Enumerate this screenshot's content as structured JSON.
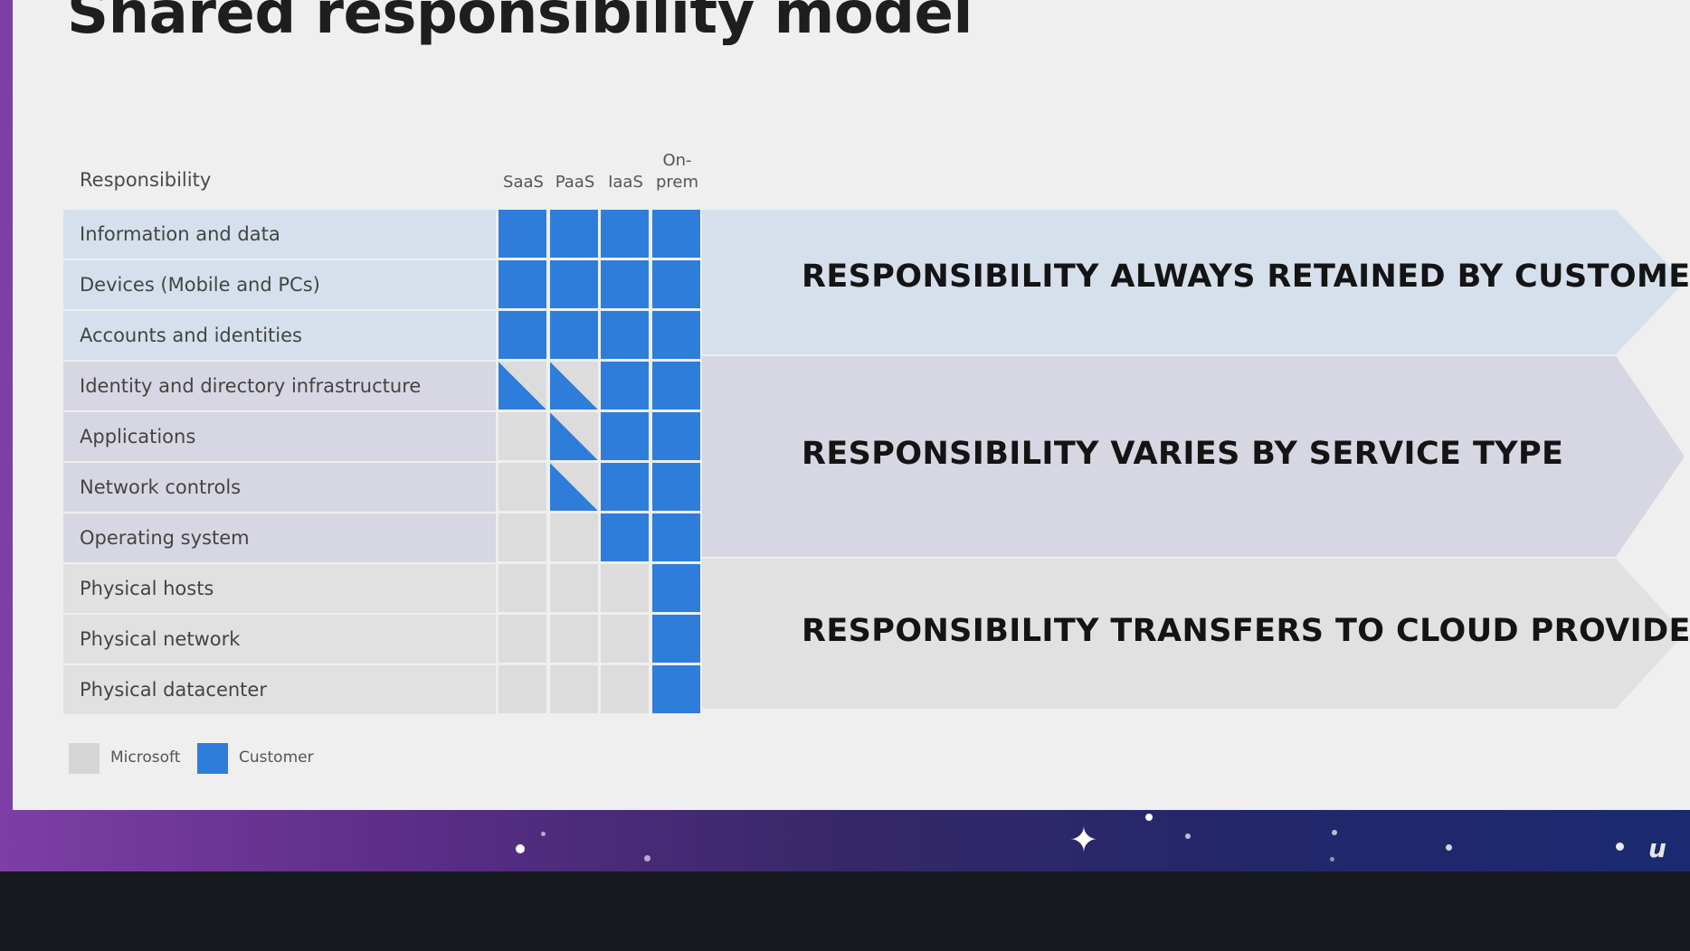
{
  "title": "Shared responsibility model",
  "header": {
    "responsibility": "Responsibility",
    "saas": "SaaS",
    "paas": "PaaS",
    "iaas": "IaaS",
    "onprem_line1": "On-",
    "onprem_line2": "prem"
  },
  "rows": [
    {
      "label": "Information and data",
      "cells": [
        "customer",
        "customer",
        "customer",
        "customer"
      ]
    },
    {
      "label": "Devices (Mobile and PCs)",
      "cells": [
        "customer",
        "customer",
        "customer",
        "customer"
      ]
    },
    {
      "label": "Accounts and identities",
      "cells": [
        "customer",
        "customer",
        "customer",
        "customer"
      ]
    },
    {
      "label": "Identity and directory infrastructure",
      "cells": [
        "shared",
        "shared",
        "customer",
        "customer"
      ]
    },
    {
      "label": "Applications",
      "cells": [
        "microsoft",
        "shared",
        "customer",
        "customer"
      ]
    },
    {
      "label": "Network controls",
      "cells": [
        "microsoft",
        "shared",
        "customer",
        "customer"
      ]
    },
    {
      "label": "Operating system",
      "cells": [
        "microsoft",
        "microsoft",
        "customer",
        "customer"
      ]
    },
    {
      "label": "Physical hosts",
      "cells": [
        "microsoft",
        "microsoft",
        "microsoft",
        "customer"
      ]
    },
    {
      "label": "Physical network",
      "cells": [
        "microsoft",
        "microsoft",
        "microsoft",
        "customer"
      ]
    },
    {
      "label": "Physical datacenter",
      "cells": [
        "microsoft",
        "microsoft",
        "microsoft",
        "customer"
      ]
    }
  ],
  "arrows": {
    "retained": "RESPONSIBILITY ALWAYS RETAINED BY CUSTOMER",
    "varies": "RESPONSIBILITY VARIES BY SERVICE TYPE",
    "transfers": "RESPONSIBILITY TRANSFERS TO CLOUD PROVIDER"
  },
  "legend": {
    "microsoft": "Microsoft",
    "customer": "Customer"
  },
  "colors": {
    "customer": "#2f7ddb",
    "microsoft": "#dcdcdc",
    "band_customer": "#d5e0ec",
    "band_varies": "#d6d7e2",
    "band_provider": "#e1e1e1"
  },
  "brand_logo": "u"
}
